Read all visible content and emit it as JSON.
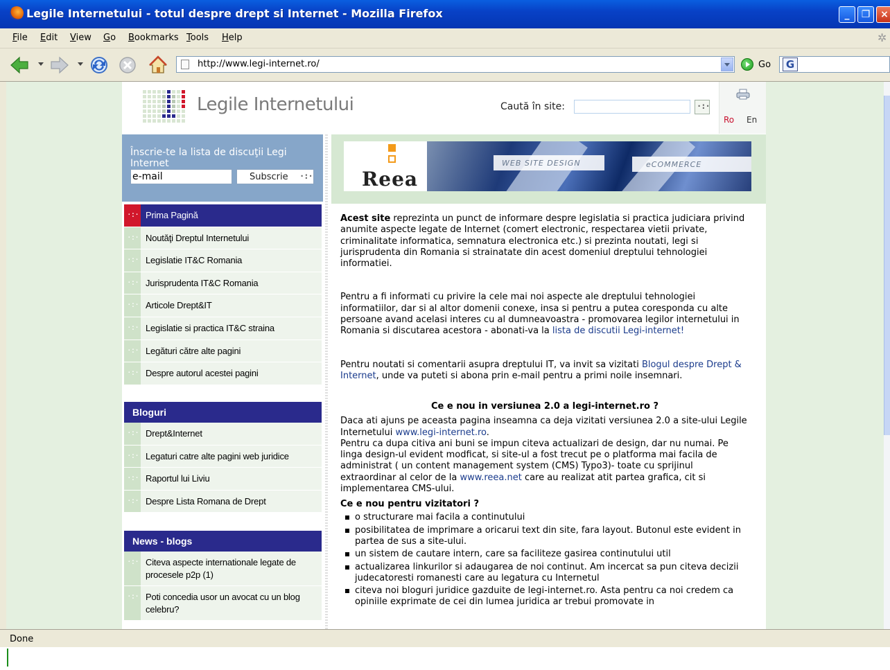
{
  "window": {
    "title": "Legile Internetului - totul despre drept si Internet - Mozilla Firefox",
    "buttons": {
      "min": "_",
      "max": "❐",
      "close": "×"
    }
  },
  "menu": [
    "File",
    "Edit",
    "View",
    "Go",
    "Bookmarks",
    "Tools",
    "Help"
  ],
  "toolbar": {
    "url": "http://www.legi-internet.ro/",
    "go_label": "Go",
    "search_engine_glyph": "G"
  },
  "status": {
    "text": "Done"
  },
  "site": {
    "logo_text": "Legile Internetului",
    "search_label": "Caută în site:",
    "search_value": "",
    "lang_ro": "Ro",
    "lang_en": "En",
    "colors": {
      "nav_blue": "#2a2a8c",
      "accent_red": "#d1172b",
      "light_green": "#e4f0e0",
      "subscribe_blue": "#86a6c9"
    }
  },
  "subscribe": {
    "title": "Înscrie-te la lista de discuţii Legi Internet",
    "email_value": "e-mail",
    "button": "Subscrie"
  },
  "nav_main": [
    "Prima Pagină",
    "Noutăţi Dreptul Internetului",
    "Legislatie IT&C Romania",
    "Jurisprudenta IT&C Romania",
    "Articole Drept&IT",
    "Legislatie si practica IT&C straina",
    "Legături către alte pagini",
    "Despre autorul acestei pagini"
  ],
  "blogs": {
    "header": "Bloguri",
    "items": [
      "Drept&Internet",
      "Legaturi catre alte pagini web juridice",
      "Raportul lui Liviu",
      "Despre Lista Romana de Drept"
    ]
  },
  "news": {
    "header": "News - blogs",
    "items": [
      "Citeva aspecte internationale legate de procesele p2p (1)",
      "Poti concedia usor un avocat cu un blog celebru?"
    ]
  },
  "banner": {
    "brand": "Reea",
    "tag1": "WEB SITE DESIGN",
    "tag2": "eCOMMERCE"
  },
  "content": {
    "p1_bold": "Acest site",
    "p1_rest": " reprezinta un punct de informare despre legislatia si practica judiciara privind anumite aspecte legate de Internet (comert electronic, respectarea vietii private, criminalitate informatica, semnatura electronica etc.) si prezinta noutati, legi si jurisprudenta din Romania si strainatate din acest domeniul dreptului tehnologiei informatiei.",
    "p2_text": "Pentru a fi informati cu privire la cele mai noi aspecte ale dreptului  tehnologiei informatiilor, dar si al altor domenii conexe, insa si pentru a putea coresponda cu alte persoane avand acelasi interes cu al dumneavoastra - promovarea legilor internetului in Romania si discutarea acestora - abonati-va la ",
    "p2_link": "lista de discutii Legi-internet!",
    "p3_a": "Pentru noutati si comentarii asupra dreptului IT, va invit sa vizitati ",
    "p3_link": "Blogul despre Drept & Internet",
    "p3_b": ", unde va puteti si abona prin e-mail pentru a primi noile insemnari.",
    "h_new": "Ce e nou in versiunea 2.0 a legi-internet.ro ?",
    "p4_a": "Daca ati ajuns pe aceasta pagina inseamna ca deja vizitati versiunea 2.0 a site-ului Legile Internetului ",
    "p4_link": "www.legi-internet.ro",
    "p4_b": ".",
    "p5_a": "Pentru ca dupa citiva ani buni se impun citeva actualizari de design, dar nu numai. Pe linga design-ul evident modficat, si site-ul a fost trecut pe o platforma mai facila de administrat ( un content management system (CMS) Typo3)- toate cu sprijinul extraordinar al celor de la ",
    "p5_link": "www.reea.net",
    "p5_b": " care au realizat atit partea grafica, cit si implementarea CMS-ului.",
    "h_visitors": "Ce e nou pentru vizitatori ?",
    "bullets": [
      "o structurare mai facila a continutului",
      "posibilitatea de imprimare a oricarui text din site, fara layout. Butonul este evident in partea de sus a site-ului.",
      "un sistem de cautare intern, care sa faciliteze gasirea continutului util",
      "actualizarea linkurilor si adaugarea de noi continut. Am incercat sa pun citeva decizii judecatoresti romanesti care au legatura cu Internetul",
      "citeva noi bloguri juridice gazduite de legi-internet.ro. Asta pentru ca noi credem ca opiniile exprimate de cei din lumea juridica ar trebui promovate in"
    ]
  }
}
